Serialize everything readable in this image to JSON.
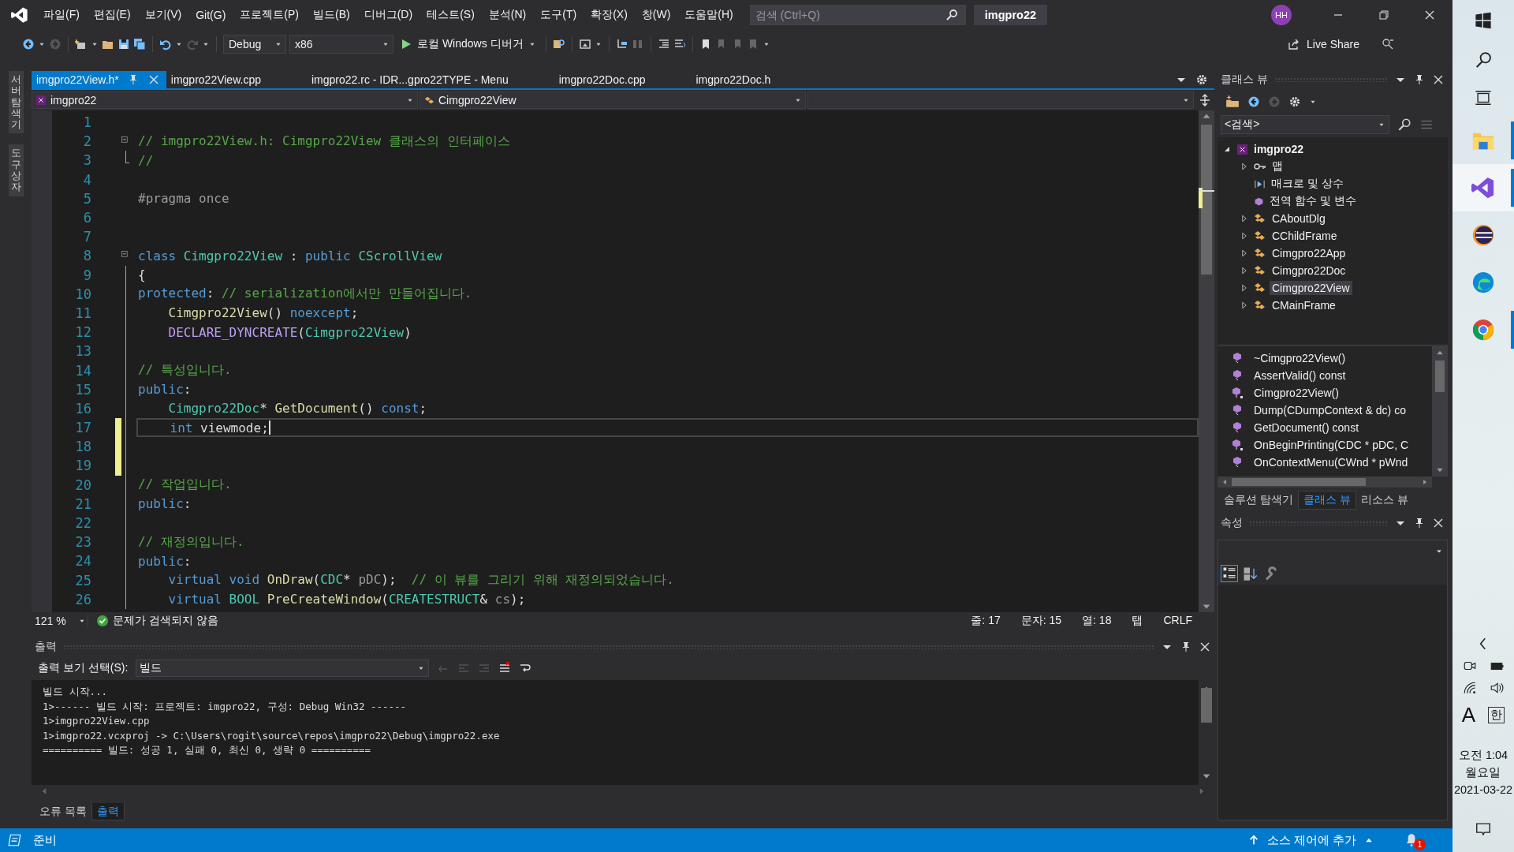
{
  "menu_bar": {
    "items": [
      "파일(F)",
      "편집(E)",
      "보기(V)",
      "Git(G)",
      "프로젝트(P)",
      "빌드(B)",
      "디버그(D)",
      "테스트(S)",
      "분석(N)",
      "도구(T)",
      "확장(X)",
      "창(W)",
      "도움말(H)"
    ],
    "search": {
      "placeholder": "검색 (Ctrl+Q)"
    },
    "solution_name": "imgpro22",
    "avatar": "HH"
  },
  "toolbar": {
    "configuration": "Debug",
    "platform": "x86",
    "debugger": "로컬 Windows 디버거",
    "live_share": "Live Share"
  },
  "side_tabs": [
    "서버 탐색기",
    "도구 상자"
  ],
  "editor": {
    "tabs": [
      {
        "label": "imgpro22View.h*",
        "selected": true
      },
      {
        "label": "imgpro22View.cpp",
        "selected": false
      },
      {
        "label": "imgpro22.rc - IDR...gpro22TYPE - Menu",
        "selected": false
      },
      {
        "label": "imgpro22Doc.cpp",
        "selected": false
      },
      {
        "label": "imgpro22Doc.h",
        "selected": false
      }
    ],
    "navigation": {
      "project": "imgpro22",
      "scope": "Cimgpro22View"
    },
    "lines": [
      {
        "number": "1",
        "changed": false,
        "current": false,
        "foldable": false
      },
      {
        "number": "2",
        "changed": false,
        "current": false,
        "foldable": true,
        "tokens": [
          {
            "kind": "comment",
            "text": "// imgpro22View.h: Cimgpro22View 클래스의 인터페이스"
          }
        ]
      },
      {
        "number": "3",
        "changed": false,
        "current": false,
        "foldable": false,
        "tokens": [
          {
            "kind": "comment",
            "text": "//"
          }
        ]
      },
      {
        "number": "4",
        "changed": false,
        "current": false,
        "foldable": false
      },
      {
        "number": "5",
        "changed": false,
        "current": false,
        "foldable": false,
        "tokens": [
          {
            "kind": "preproc",
            "text": "#pragma once"
          }
        ]
      },
      {
        "number": "6",
        "changed": false,
        "current": false,
        "foldable": false
      },
      {
        "number": "7",
        "changed": false,
        "current": false,
        "foldable": false
      },
      {
        "number": "8",
        "changed": false,
        "current": false,
        "foldable": true,
        "tokens": [
          {
            "kind": "keyword",
            "text": "class "
          },
          {
            "kind": "type",
            "text": "Cimgpro22View"
          },
          {
            "kind": "plain",
            "text": " : "
          },
          {
            "kind": "keyword",
            "text": "public "
          },
          {
            "kind": "type",
            "text": "CScrollView"
          }
        ]
      },
      {
        "number": "9",
        "changed": false,
        "current": false,
        "foldable": false,
        "tokens": [
          {
            "kind": "plain",
            "text": "{"
          }
        ]
      },
      {
        "number": "10",
        "changed": false,
        "current": false,
        "foldable": false,
        "tokens": [
          {
            "kind": "keyword",
            "text": "protected"
          },
          {
            "kind": "plain",
            "text": ": "
          },
          {
            "kind": "comment",
            "text": "// serialization에서만 만들어집니다."
          }
        ]
      },
      {
        "number": "11",
        "changed": false,
        "current": false,
        "foldable": false,
        "tokens": [
          {
            "kind": "function",
            "text": "    Cimgpro22View"
          },
          {
            "kind": "plain",
            "text": "() "
          },
          {
            "kind": "keyword",
            "text": "noexcept"
          },
          {
            "kind": "plain",
            "text": ";"
          }
        ]
      },
      {
        "number": "12",
        "changed": false,
        "current": false,
        "foldable": false,
        "tokens": [
          {
            "kind": "macro",
            "text": "    DECLARE_DYNCREATE"
          },
          {
            "kind": "plain",
            "text": "("
          },
          {
            "kind": "type",
            "text": "Cimgpro22View"
          },
          {
            "kind": "plain",
            "text": ")"
          }
        ]
      },
      {
        "number": "13",
        "changed": false,
        "current": false,
        "foldable": false
      },
      {
        "number": "14",
        "changed": false,
        "current": false,
        "foldable": false,
        "tokens": [
          {
            "kind": "comment",
            "text": "// 특성입니다."
          }
        ]
      },
      {
        "number": "15",
        "changed": false,
        "current": false,
        "foldable": false,
        "tokens": [
          {
            "kind": "keyword",
            "text": "public"
          },
          {
            "kind": "plain",
            "text": ":"
          }
        ]
      },
      {
        "number": "16",
        "changed": false,
        "current": false,
        "foldable": false,
        "tokens": [
          {
            "kind": "type",
            "text": "    Cimgpro22Doc"
          },
          {
            "kind": "plain",
            "text": "* "
          },
          {
            "kind": "function",
            "text": "GetDocument"
          },
          {
            "kind": "plain",
            "text": "() "
          },
          {
            "kind": "keyword",
            "text": "const"
          },
          {
            "kind": "plain",
            "text": ";"
          }
        ]
      },
      {
        "number": "17",
        "changed": true,
        "current": true,
        "foldable": false,
        "tokens": [
          {
            "kind": "keyword",
            "text": "    int "
          },
          {
            "kind": "plain",
            "text": "viewmode;"
          }
        ]
      },
      {
        "number": "18",
        "changed": true,
        "current": false,
        "foldable": false
      },
      {
        "number": "19",
        "changed": true,
        "current": false,
        "foldable": false
      },
      {
        "number": "20",
        "changed": false,
        "current": false,
        "foldable": false,
        "tokens": [
          {
            "kind": "comment",
            "text": "// 작업입니다."
          }
        ]
      },
      {
        "number": "21",
        "changed": false,
        "current": false,
        "foldable": false,
        "tokens": [
          {
            "kind": "keyword",
            "text": "public"
          },
          {
            "kind": "plain",
            "text": ":"
          }
        ]
      },
      {
        "number": "22",
        "changed": false,
        "current": false,
        "foldable": false
      },
      {
        "number": "23",
        "changed": false,
        "current": false,
        "foldable": false,
        "tokens": [
          {
            "kind": "comment",
            "text": "// 재정의입니다."
          }
        ]
      },
      {
        "number": "24",
        "changed": false,
        "current": false,
        "foldable": false,
        "tokens": [
          {
            "kind": "keyword",
            "text": "public"
          },
          {
            "kind": "plain",
            "text": ":"
          }
        ]
      },
      {
        "number": "25",
        "changed": false,
        "current": false,
        "foldable": false,
        "tokens": [
          {
            "kind": "keyword",
            "text": "    virtual void "
          },
          {
            "kind": "function",
            "text": "OnDraw"
          },
          {
            "kind": "plain",
            "text": "("
          },
          {
            "kind": "type",
            "text": "CDC"
          },
          {
            "kind": "plain",
            "text": "* "
          },
          {
            "kind": "param",
            "text": "pDC"
          },
          {
            "kind": "plain",
            "text": ");  "
          },
          {
            "kind": "comment",
            "text": "// 이 뷰를 그리기 위해 재정의되었습니다."
          }
        ]
      },
      {
        "number": "26",
        "changed": false,
        "current": false,
        "foldable": false,
        "tokens": [
          {
            "kind": "keyword",
            "text": "    virtual "
          },
          {
            "kind": "type",
            "text": "BOOL "
          },
          {
            "kind": "function",
            "text": "PreCreateWindow"
          },
          {
            "kind": "plain",
            "text": "("
          },
          {
            "kind": "type",
            "text": "CREATESTRUCT"
          },
          {
            "kind": "plain",
            "text": "& "
          },
          {
            "kind": "param",
            "text": "cs"
          },
          {
            "kind": "plain",
            "text": ");"
          }
        ]
      }
    ],
    "status": {
      "zoom": "121 %",
      "issues": "문제가 검색되지 않음",
      "line": "줄: 17",
      "character": "문자: 15",
      "column": "열: 18",
      "indent": "탭",
      "line_ending": "CRLF"
    }
  },
  "output": {
    "title": "출력",
    "source_label": "출력 보기 선택(S):",
    "source": "빌드",
    "lines": [
      "빌드 시작...",
      "1>------ 빌드 시작: 프로젝트: imgpro22, 구성: Debug Win32 ------",
      "1>imgpro22View.cpp",
      "1>imgpro22.vcxproj -> C:\\Users\\rogit\\source\\repos\\imgpro22\\Debug\\imgpro22.exe",
      "========== 빌드: 성공 1, 실패 0, 최신 0, 생략 0 =========="
    ]
  },
  "bottom_tabs": [
    {
      "label": "오류 목록",
      "selected": false
    },
    {
      "label": "출력",
      "selected": true
    }
  ],
  "class_view": {
    "title": "클래스 뷰",
    "search": "<검색>",
    "tree": [
      {
        "label": "imgpro22",
        "kind": "project",
        "expanded": true,
        "selected": false,
        "children": [
          {
            "label": "맵",
            "kind": "map",
            "expanded": false,
            "selected": false
          },
          {
            "label": "매크로 및 상수",
            "kind": "macro",
            "selected": false
          },
          {
            "label": "전역 함수 및 변수",
            "kind": "global",
            "selected": false
          },
          {
            "label": "CAboutDlg",
            "kind": "class",
            "expanded": false,
            "selected": false
          },
          {
            "label": "CChildFrame",
            "kind": "class",
            "expanded": false,
            "selected": false
          },
          {
            "label": "Cimgpro22App",
            "kind": "class",
            "expanded": false,
            "selected": false
          },
          {
            "label": "Cimgpro22Doc",
            "kind": "class",
            "expanded": false,
            "selected": false
          },
          {
            "label": "Cimgpro22View",
            "kind": "class",
            "expanded": false,
            "selected": true
          },
          {
            "label": "CMainFrame",
            "kind": "class",
            "expanded": false,
            "selected": false
          }
        ]
      }
    ],
    "members": [
      {
        "label": "~Cimgpro22View()",
        "kind": "plain"
      },
      {
        "label": "AssertValid() const",
        "kind": "plain"
      },
      {
        "label": "Cimgpro22View()",
        "kind": "marked"
      },
      {
        "label": "Dump(CDumpContext & dc) co",
        "kind": "plain"
      },
      {
        "label": "GetDocument() const",
        "kind": "plain"
      },
      {
        "label": "OnBeginPrinting(CDC * pDC, C",
        "kind": "marked"
      },
      {
        "label": "OnContextMenu(CWnd * pWnd",
        "kind": "plain"
      }
    ],
    "tabs": [
      {
        "label": "솔루션 탐색기",
        "selected": false
      },
      {
        "label": "클래스 뷰",
        "selected": true
      },
      {
        "label": "리소스 뷰",
        "selected": false
      }
    ]
  },
  "properties": {
    "title": "속성"
  },
  "status_bar": {
    "text": "준비",
    "source_control": "소스 제어에 추가",
    "notifications": "1"
  },
  "taskbar": {
    "apps": [
      {
        "kind": "folder",
        "running": true,
        "selected": false
      },
      {
        "kind": "studio",
        "running": true,
        "selected": true
      },
      {
        "kind": "eclipse",
        "running": false,
        "selected": false
      },
      {
        "kind": "edge",
        "running": false,
        "selected": false
      },
      {
        "kind": "chrome",
        "running": true,
        "selected": false
      }
    ],
    "input_mode": "A",
    "ime": "한",
    "time": "오전 1:04",
    "day": "월요일",
    "date": "2021-03-22"
  }
}
